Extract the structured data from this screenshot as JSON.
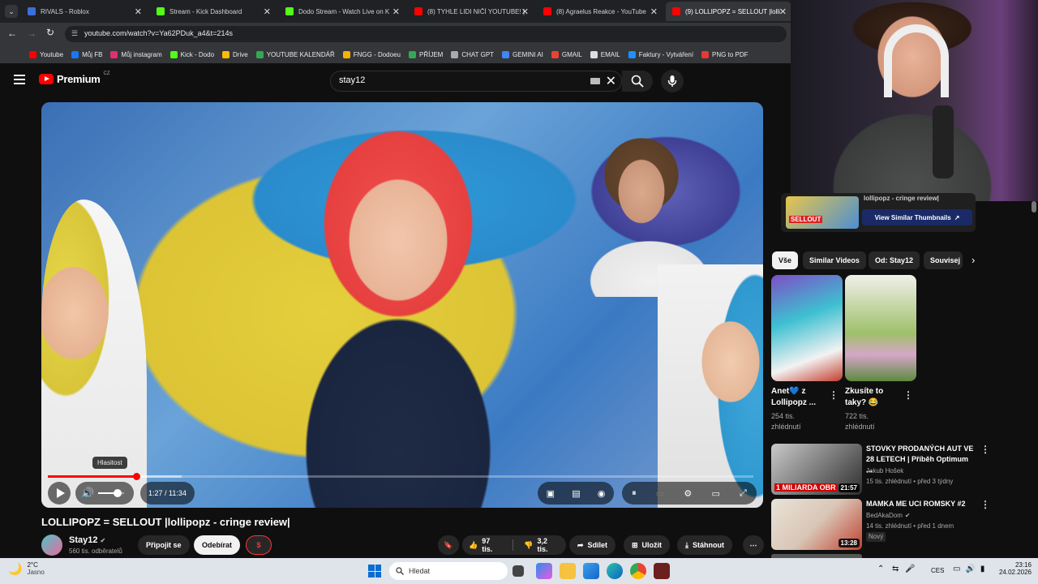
{
  "browser": {
    "tabs": [
      {
        "label": "RIVALS - Roblox",
        "color": "#3b6fd8"
      },
      {
        "label": "Stream - Kick Dashboard",
        "color": "#53fc18"
      },
      {
        "label": "Dodo Stream - Watch Live on K",
        "color": "#53fc18"
      },
      {
        "label": "(8) TYHLE LIDI NIČÍ YOUTUBE! |",
        "color": "#ff0000"
      },
      {
        "label": "(8) Agraelus Reakce - YouTube",
        "color": "#ff0000"
      },
      {
        "label": "(9) LOLLIPOPZ = SELLOUT |lolli",
        "color": "#ff0000"
      }
    ],
    "url": "youtube.com/watch?v=Ya62PDuk_a4&t=214s",
    "bookmarks": [
      {
        "label": "Youtube",
        "color": "#ff0000"
      },
      {
        "label": "Můj FB",
        "color": "#1877f2"
      },
      {
        "label": "Můj instagram",
        "color": "#e1306c"
      },
      {
        "label": "Kick - Dodo",
        "color": "#53fc18"
      },
      {
        "label": "Drive",
        "color": "#fbbc04"
      },
      {
        "label": "YOUTUBE KALENDÁŘ",
        "color": "#34a853"
      },
      {
        "label": "FNGG - Dodoeu",
        "color": "#f4b400"
      },
      {
        "label": "PŘÍJEM",
        "color": "#34a853"
      },
      {
        "label": "CHAT GPT",
        "color": "#aaaaaa"
      },
      {
        "label": "GEMINI AI",
        "color": "#4285f4"
      },
      {
        "label": "GMAIL",
        "color": "#ea4335"
      },
      {
        "label": "EMAIL",
        "color": "#dddddd"
      },
      {
        "label": "Faktury - Vytváření",
        "color": "#1e90ff"
      },
      {
        "label": "PNG to PDF",
        "color": "#e53935"
      }
    ]
  },
  "youtube": {
    "logo": "Premium",
    "region": "CZ",
    "search_value": "stay12"
  },
  "player": {
    "volume_tooltip": "Hlasitost",
    "time": "1:27 / 11:34",
    "progress": 0.125,
    "buffered": 0.19,
    "volume": 0.75
  },
  "video": {
    "title": "LOLLIPOPZ = SELLOUT |lollipopz - cringe review|",
    "channel": "Stay12",
    "subscribers": "560 tis. odběratelů",
    "join_label": "Připojit se",
    "subscribe_label": "Odebírat",
    "likes": "97 tis.",
    "dislikes": "3,2 tis.",
    "share_label": "Sdílet",
    "save_label": "Uložit",
    "download_label": "Stáhnout"
  },
  "sidebar": {
    "partial_title": "lollipopz - cringe review|",
    "similar_thumbs_label": "View Similar Thumbnails",
    "thumb_badge": "SELLOUT",
    "chips": [
      "Vše",
      "Similar Videos",
      "Od: Stay12",
      "Souvisej"
    ],
    "shorts": [
      {
        "title": "Anet💙 z Lollipopz ...",
        "views": "254 tis. zhlédnutí"
      },
      {
        "title": "Zkusíte to taky? 😂",
        "views": "722 tis. zhlédnutí"
      }
    ],
    "videos": [
      {
        "title": "STOVKY PRODANÝCH AUT VE 28 LETECH | Příběh Optimum ...",
        "channel": "Jakub Hošek",
        "meta": "15 tis. zhlédnutí • před 3 týdny",
        "duration": "21:57",
        "overlay": "1 MILIARDA OBR"
      },
      {
        "title": "MAMKA ME UCI ROMSKY #2",
        "channel": "BedAkaDom",
        "meta": "14 tis. zhlédnutí • před 1 dnem",
        "badge": "Nový",
        "duration": "13:28"
      }
    ]
  },
  "taskbar": {
    "weather_temp": "2°C",
    "weather_desc": "Jasno",
    "search_placeholder": "Hledat",
    "language": "CES",
    "time": "23:16",
    "date": "24.02.2026"
  }
}
